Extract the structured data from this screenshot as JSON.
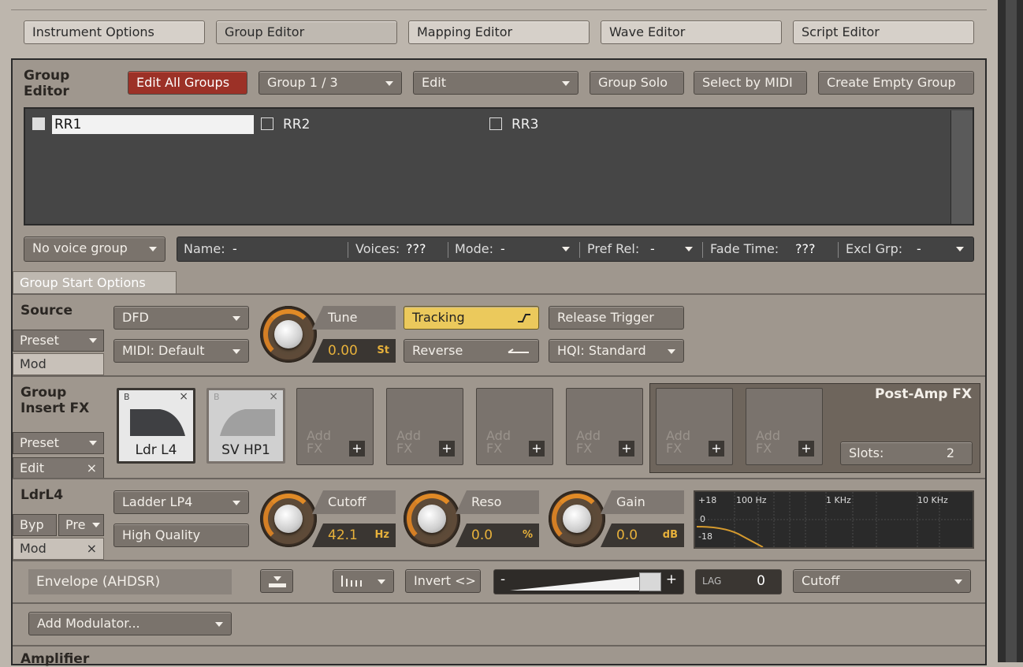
{
  "tabs": [
    "Instrument Options",
    "Group Editor",
    "Mapping Editor",
    "Wave Editor",
    "Script Editor"
  ],
  "group_editor": {
    "title_line1": "Group",
    "title_line2": "Editor",
    "edit_all_groups": "Edit All Groups",
    "group_select": "Group 1 / 3",
    "edit_menu": "Edit",
    "group_solo": "Group Solo",
    "select_by_midi": "Select by MIDI",
    "create_empty_group": "Create Empty Group",
    "groups": [
      "RR1",
      "RR2",
      "RR3"
    ],
    "voice_group": "No voice group",
    "info": {
      "name_label": "Name:",
      "name_value": "-",
      "voices_label": "Voices:",
      "voices_value": "???",
      "mode_label": "Mode:",
      "mode_value": "-",
      "pref_rel_label": "Pref Rel:",
      "pref_rel_value": "-",
      "fade_time_label": "Fade Time:",
      "fade_time_value": "???",
      "excl_grp_label": "Excl Grp:",
      "excl_grp_value": "-"
    },
    "group_start_options": "Group Start Options"
  },
  "source": {
    "title": "Source",
    "preset": "Preset",
    "mod": "Mod",
    "mode": "DFD",
    "midi": "MIDI: Default",
    "tune_label": "Tune",
    "tune_value": "0.00",
    "tune_unit": "St",
    "tracking": "Tracking",
    "reverse": "Reverse",
    "release_trigger": "Release Trigger",
    "hqi": "HQI: Standard"
  },
  "insert_fx": {
    "title_line1": "Group",
    "title_line2": "Insert FX",
    "preset": "Preset",
    "edit": "Edit",
    "slot_b_label": "B",
    "slots": [
      {
        "name": "Ldr L4",
        "loaded": true,
        "selected": true
      },
      {
        "name": "SV HP1",
        "loaded": true,
        "selected": false
      }
    ],
    "empty_slot_line1": "Add",
    "empty_slot_line2": "FX",
    "empty_count": 4,
    "post_amp": "Post-Amp FX",
    "slots_label": "Slots:",
    "slots_value": "2"
  },
  "filter": {
    "title": "LdrL4",
    "byp": "Byp",
    "pre": "Pre",
    "mod": "Mod",
    "type": "Ladder LP4",
    "quality": "High Quality",
    "cutoff_label": "Cutoff",
    "cutoff_value": "42.1",
    "cutoff_unit": "Hz",
    "reso_label": "Reso",
    "reso_value": "0.0",
    "reso_unit": "%",
    "gain_label": "Gain",
    "gain_value": "0.0",
    "gain_unit": "dB",
    "graph": {
      "db_top": "+18",
      "db_mid": "0",
      "db_bottom": "-18",
      "f1": "100 Hz",
      "f2": "1 KHz",
      "f3": "10 KHz"
    }
  },
  "modulation": {
    "envelope": "Envelope (AHDSR)",
    "invert": "Invert <>",
    "minus": "-",
    "plus": "+",
    "lag_label": "LAG",
    "lag_value": "0",
    "target": "Cutoff",
    "add_modulator": "Add Modulator..."
  },
  "amplifier": {
    "title": "Amplifier"
  }
}
